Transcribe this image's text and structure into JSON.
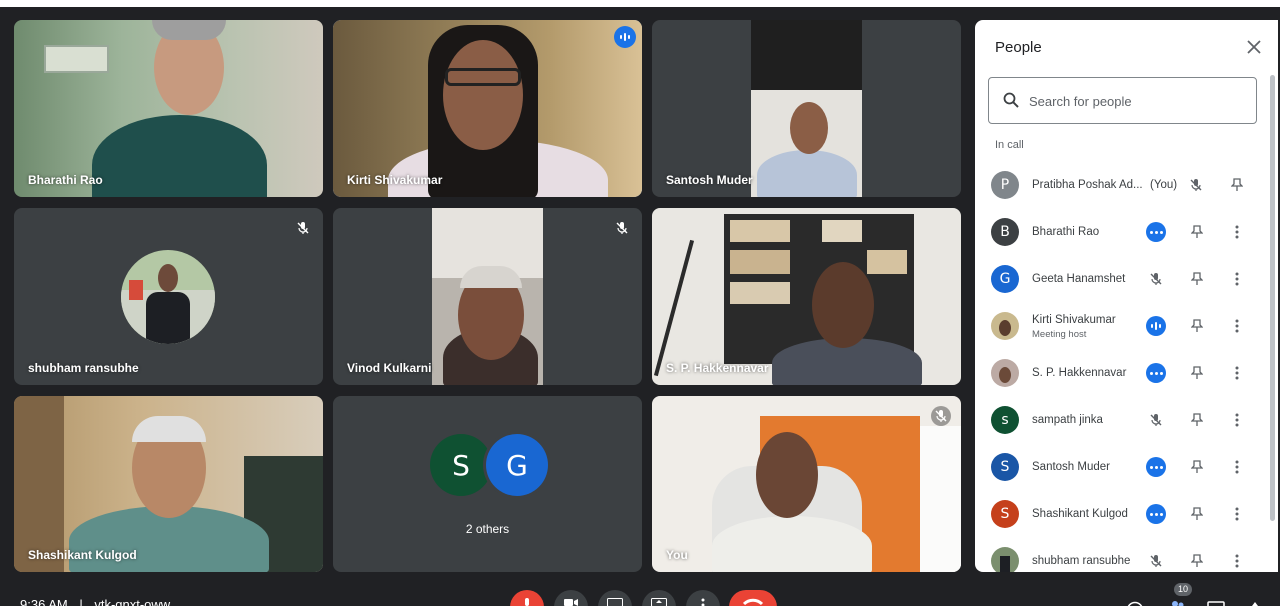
{
  "participants_tiles": [
    {
      "name": "Bharathi Rao"
    },
    {
      "name": "Kirti Shivakumar"
    },
    {
      "name": "Santosh Muder"
    },
    {
      "name": "shubham ransubhe"
    },
    {
      "name": "Vinod Kulkarni"
    },
    {
      "name": "S. P. Hakkennavar"
    },
    {
      "name": "Shashikant Kulgod"
    },
    {
      "name": "2 others",
      "letters": [
        "S",
        "G"
      ]
    },
    {
      "name": "You"
    }
  ],
  "panel": {
    "title": "People",
    "search_placeholder": "Search for people",
    "section_label": "In call",
    "people": [
      {
        "initial": "P",
        "name": "Pratibha Poshak Ad...",
        "tag": "(You)",
        "color": "#80868b",
        "audio": "muted"
      },
      {
        "initial": "B",
        "name": "Bharathi Rao",
        "color": "#3c4043",
        "audio": "active"
      },
      {
        "initial": "G",
        "name": "Geeta Hanamshet",
        "color": "#1967d2",
        "audio": "muted"
      },
      {
        "initial": "",
        "name": "Kirti Shivakumar",
        "subtitle": "Meeting host",
        "color": "#9aa0a6",
        "audio": "speaking"
      },
      {
        "initial": "",
        "name": "S. P. Hakkennavar",
        "color": "#bcaaa4",
        "audio": "active"
      },
      {
        "initial": "s",
        "name": "sampath jinka",
        "color": "#0f5132",
        "audio": "muted"
      },
      {
        "initial": "S",
        "name": "Santosh Muder",
        "color": "#1a56a6",
        "audio": "active"
      },
      {
        "initial": "S",
        "name": "Shashikant Kulgod",
        "color": "#c5401b",
        "audio": "active"
      },
      {
        "initial": "",
        "name": "shubham ransubhe",
        "color": "#7b8f6e",
        "audio": "muted"
      }
    ]
  },
  "bottom": {
    "time": "9:36 AM",
    "separator": "|",
    "meeting_code": "vtk-gnxt-oww",
    "people_count": "10"
  },
  "colors": {
    "background": "#202124",
    "tile": "#3c4043",
    "accent_blue": "#1a73e8",
    "red": "#ea4335"
  }
}
